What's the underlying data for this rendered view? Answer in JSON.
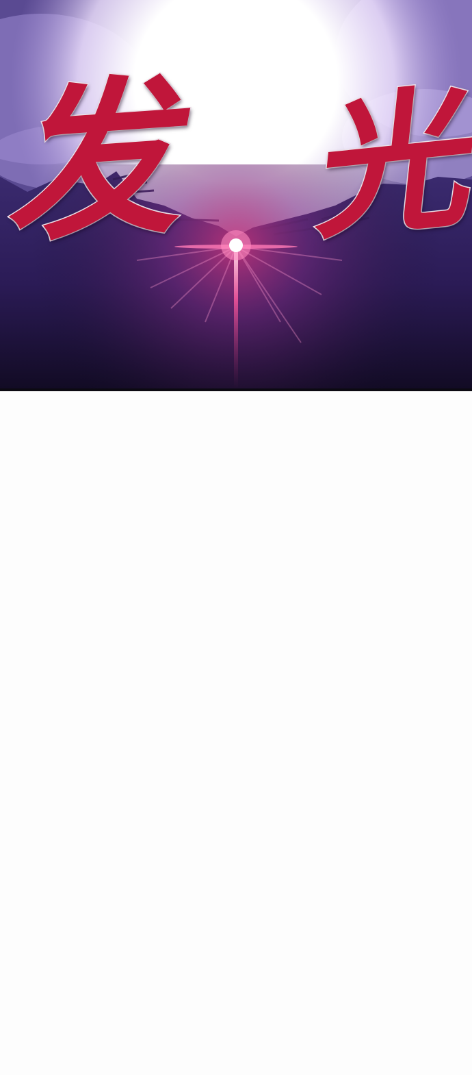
{
  "panel": {
    "sound_effect_left": "发",
    "sound_effect_right": "光",
    "colors": {
      "sky_top": "#6a5aa0",
      "sky_bottom": "#150d2a",
      "glow": "#ffffff",
      "flare": "#e0307a",
      "lettering": "#c0163a",
      "lettering_outline": "#f3e6ee"
    }
  }
}
